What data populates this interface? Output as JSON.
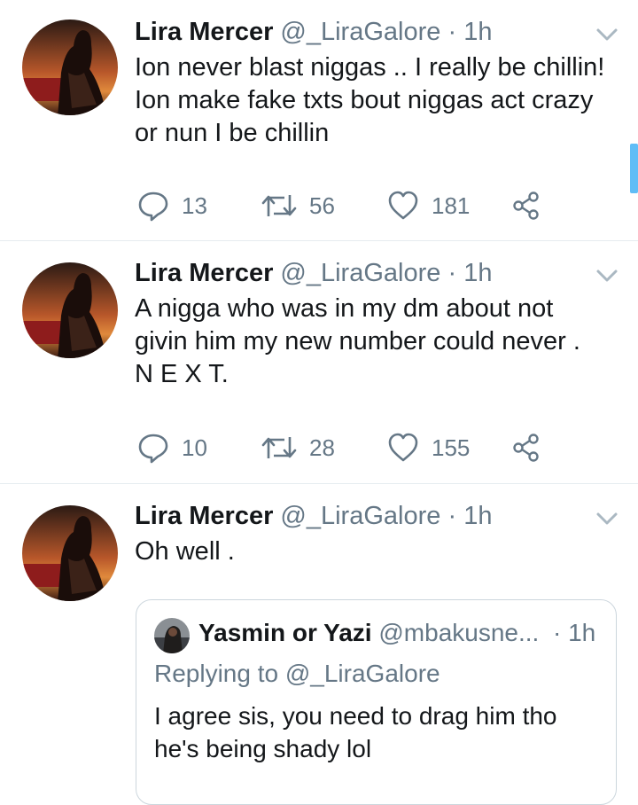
{
  "colors": {
    "text": "#14171a",
    "secondary": "#657786",
    "divider": "#e6ecf0",
    "accent": "#1da1f2"
  },
  "tweets": [
    {
      "author": {
        "name": "Lira Mercer",
        "handle": "@_LiraGalore"
      },
      "separator": "·",
      "time": "1h",
      "lines": [
        "Ion never blast niggas .. I really be chillin!",
        "Ion make fake txts bout niggas act crazy",
        "or nun I be chillin"
      ],
      "stats": {
        "replies": "13",
        "retweets": "56",
        "likes": "181"
      },
      "icons": {
        "reply": "reply-icon",
        "retweet": "retweet-icon",
        "like": "heart-icon",
        "share": "share-icon",
        "menu": "chevron-down-icon"
      }
    },
    {
      "author": {
        "name": "Lira Mercer",
        "handle": "@_LiraGalore"
      },
      "separator": "·",
      "time": "1h",
      "lines": [
        "A nigga who was in my dm about not",
        "givin him my new number could never .",
        "N E X T."
      ],
      "stats": {
        "replies": "10",
        "retweets": "28",
        "likes": "155"
      },
      "icons": {
        "reply": "reply-icon",
        "retweet": "retweet-icon",
        "like": "heart-icon",
        "share": "share-icon",
        "menu": "chevron-down-icon"
      }
    },
    {
      "author": {
        "name": "Lira Mercer",
        "handle": "@_LiraGalore"
      },
      "separator": "·",
      "time": "1h",
      "lines": [
        "Oh well ."
      ],
      "quoted": {
        "author": {
          "name": "Yasmin or Yazi",
          "handle": "@mbakusne..."
        },
        "separator": "·",
        "time": "1h",
        "replying_to": "Replying to @_LiraGalore",
        "lines": [
          "I agree sis, you need to drag him tho",
          "he's being shady lol"
        ]
      },
      "icons": {
        "menu": "chevron-down-icon"
      }
    }
  ]
}
